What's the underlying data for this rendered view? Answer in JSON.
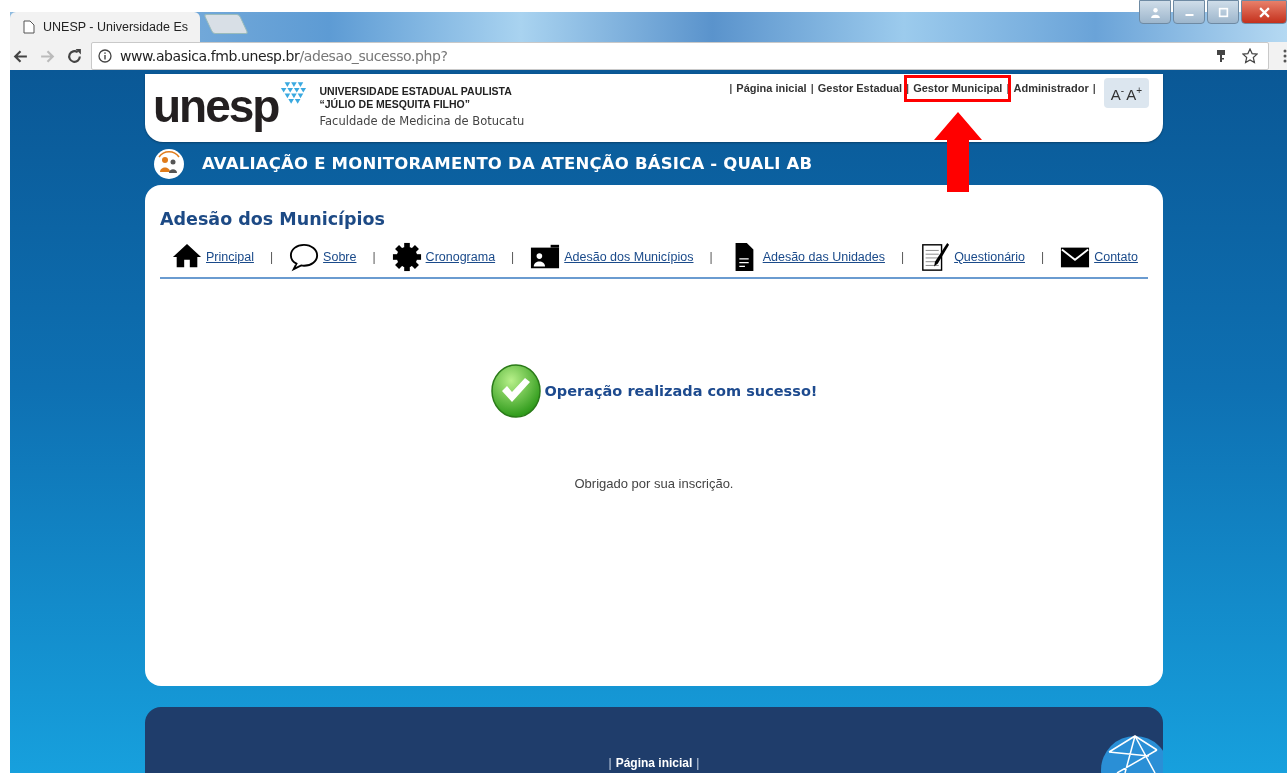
{
  "browser": {
    "tab_title": "UNESP - Universidade Es",
    "url_host": "www.abasica.fmb.unesp.br",
    "url_path": "/adesao_sucesso.php?"
  },
  "header": {
    "logo_text": "unesp",
    "university": [
      "UNIVERSIDADE ESTADUAL PAULISTA",
      "“JÚLIO DE MESQUITA FILHO”"
    ],
    "faculty": "Faculdade de Medicina de Botucatu",
    "top_links": [
      {
        "kind": "separator",
        "text": "|"
      },
      {
        "kind": "link",
        "text": "Página inicial",
        "highlighted": false
      },
      {
        "kind": "separator",
        "text": "|"
      },
      {
        "kind": "link",
        "text": "Gestor Estadual",
        "highlighted": false
      },
      {
        "kind": "separator",
        "text": "|"
      },
      {
        "kind": "link",
        "text": "Gestor Municipal",
        "highlighted": true
      },
      {
        "kind": "separator",
        "text": "|"
      },
      {
        "kind": "link",
        "text": "Administrador",
        "highlighted": false
      },
      {
        "kind": "separator",
        "text": "|"
      }
    ],
    "font_buttons": [
      "A$^{-}$",
      "A$^{+}$"
    ]
  },
  "banner": {
    "title": "AVALIAÇÃO E MONITORAMENTO DA ATENÇÃO BÁSICA - QUALI AB"
  },
  "content": {
    "heading": "Adesão dos Municípios",
    "menu": [
      {
        "kind": "link",
        "text": "Principal"
      },
      {
        "kind": "separator",
        "text": "|"
      },
      {
        "kind": "link",
        "text": "Sobre"
      },
      {
        "kind": "separator",
        "text": "|"
      },
      {
        "kind": "link",
        "text": "Cronograma"
      },
      {
        "kind": "separator",
        "text": "|"
      },
      {
        "kind": "link",
        "text": "Adesão dos Municípios"
      },
      {
        "kind": "separator",
        "text": "|"
      },
      {
        "kind": "link",
        "text": "Adesão das Unidades"
      },
      {
        "kind": "separator",
        "text": "|"
      },
      {
        "kind": "link",
        "text": "Questionário"
      },
      {
        "kind": "separator",
        "text": "|"
      },
      {
        "kind": "link",
        "text": "Contato"
      }
    ],
    "message": "Operação realizada com sucesso!",
    "note": "Obrigado por sua inscrição."
  },
  "footer": {
    "links": [
      {
        "kind": "separator",
        "text": "|"
      },
      {
        "kind": "link",
        "text": "Página inicial"
      },
      {
        "kind": "separator",
        "text": "|"
      }
    ]
  }
}
